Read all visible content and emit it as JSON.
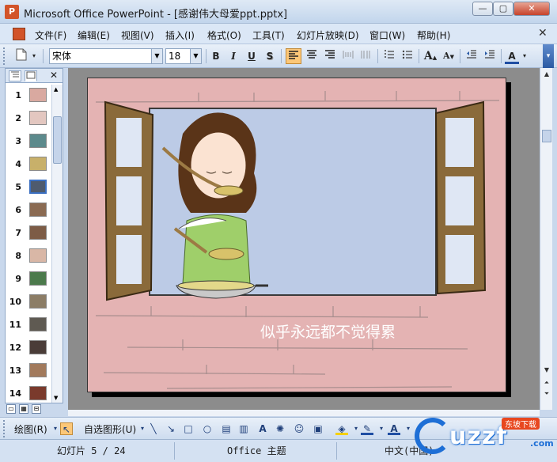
{
  "window": {
    "app_icon": "powerpoint-icon",
    "title": "Microsoft Office PowerPoint - [感谢伟大母爱ppt.pptx]",
    "min_glyph": "—",
    "max_glyph": "▢",
    "close_glyph": "✕"
  },
  "menu": {
    "items": [
      "文件(F)",
      "编辑(E)",
      "视图(V)",
      "插入(I)",
      "格式(O)",
      "工具(T)",
      "幻灯片放映(D)",
      "窗口(W)",
      "帮助(H)"
    ],
    "close_glyph": "✕"
  },
  "toolbar": {
    "font_name": "宋体",
    "font_size": "18",
    "bold": "B",
    "italic": "I",
    "underline": "U",
    "shadow": "S",
    "font_color_glyph": "A",
    "grow_glyph": "A",
    "shrink_glyph": "A"
  },
  "left_pane": {
    "close_glyph": "✕",
    "slides": [
      {
        "num": "1",
        "color": "#d9a9a0"
      },
      {
        "num": "2",
        "color": "#e3c7c0"
      },
      {
        "num": "3",
        "color": "#5c8a8c"
      },
      {
        "num": "4",
        "color": "#c8b06a"
      },
      {
        "num": "5",
        "color": "#4f5b6e",
        "selected": true
      },
      {
        "num": "6",
        "color": "#8a6a52"
      },
      {
        "num": "7",
        "color": "#7d5c46"
      },
      {
        "num": "8",
        "color": "#d9b7a6"
      },
      {
        "num": "9",
        "color": "#4c7a4c"
      },
      {
        "num": "10",
        "color": "#8c7d66"
      },
      {
        "num": "11",
        "color": "#5f5a52"
      },
      {
        "num": "12",
        "color": "#4a3c38"
      },
      {
        "num": "13",
        "color": "#a27a5c"
      },
      {
        "num": "14",
        "color": "#7a3a2c"
      }
    ]
  },
  "slide": {
    "caption": "似乎永远都不觉得累"
  },
  "drawbar": {
    "draw_label": "绘图(R)",
    "autoshapes_label": "自选图形(U)"
  },
  "status": {
    "slide_info": "幻灯片 5 / 24",
    "theme": "Office 主题",
    "language": "中文(中国)"
  },
  "watermark": {
    "text": "uzzf",
    "domain": ".com",
    "badge": "东坡下载"
  },
  "colors": {
    "slide_background": "#e4b3b3",
    "window_sky": "#bccbe6",
    "shutter_frame": "#8a6a3a",
    "apron": "#9fcf6a",
    "accent_highlight": "#fcc778"
  }
}
